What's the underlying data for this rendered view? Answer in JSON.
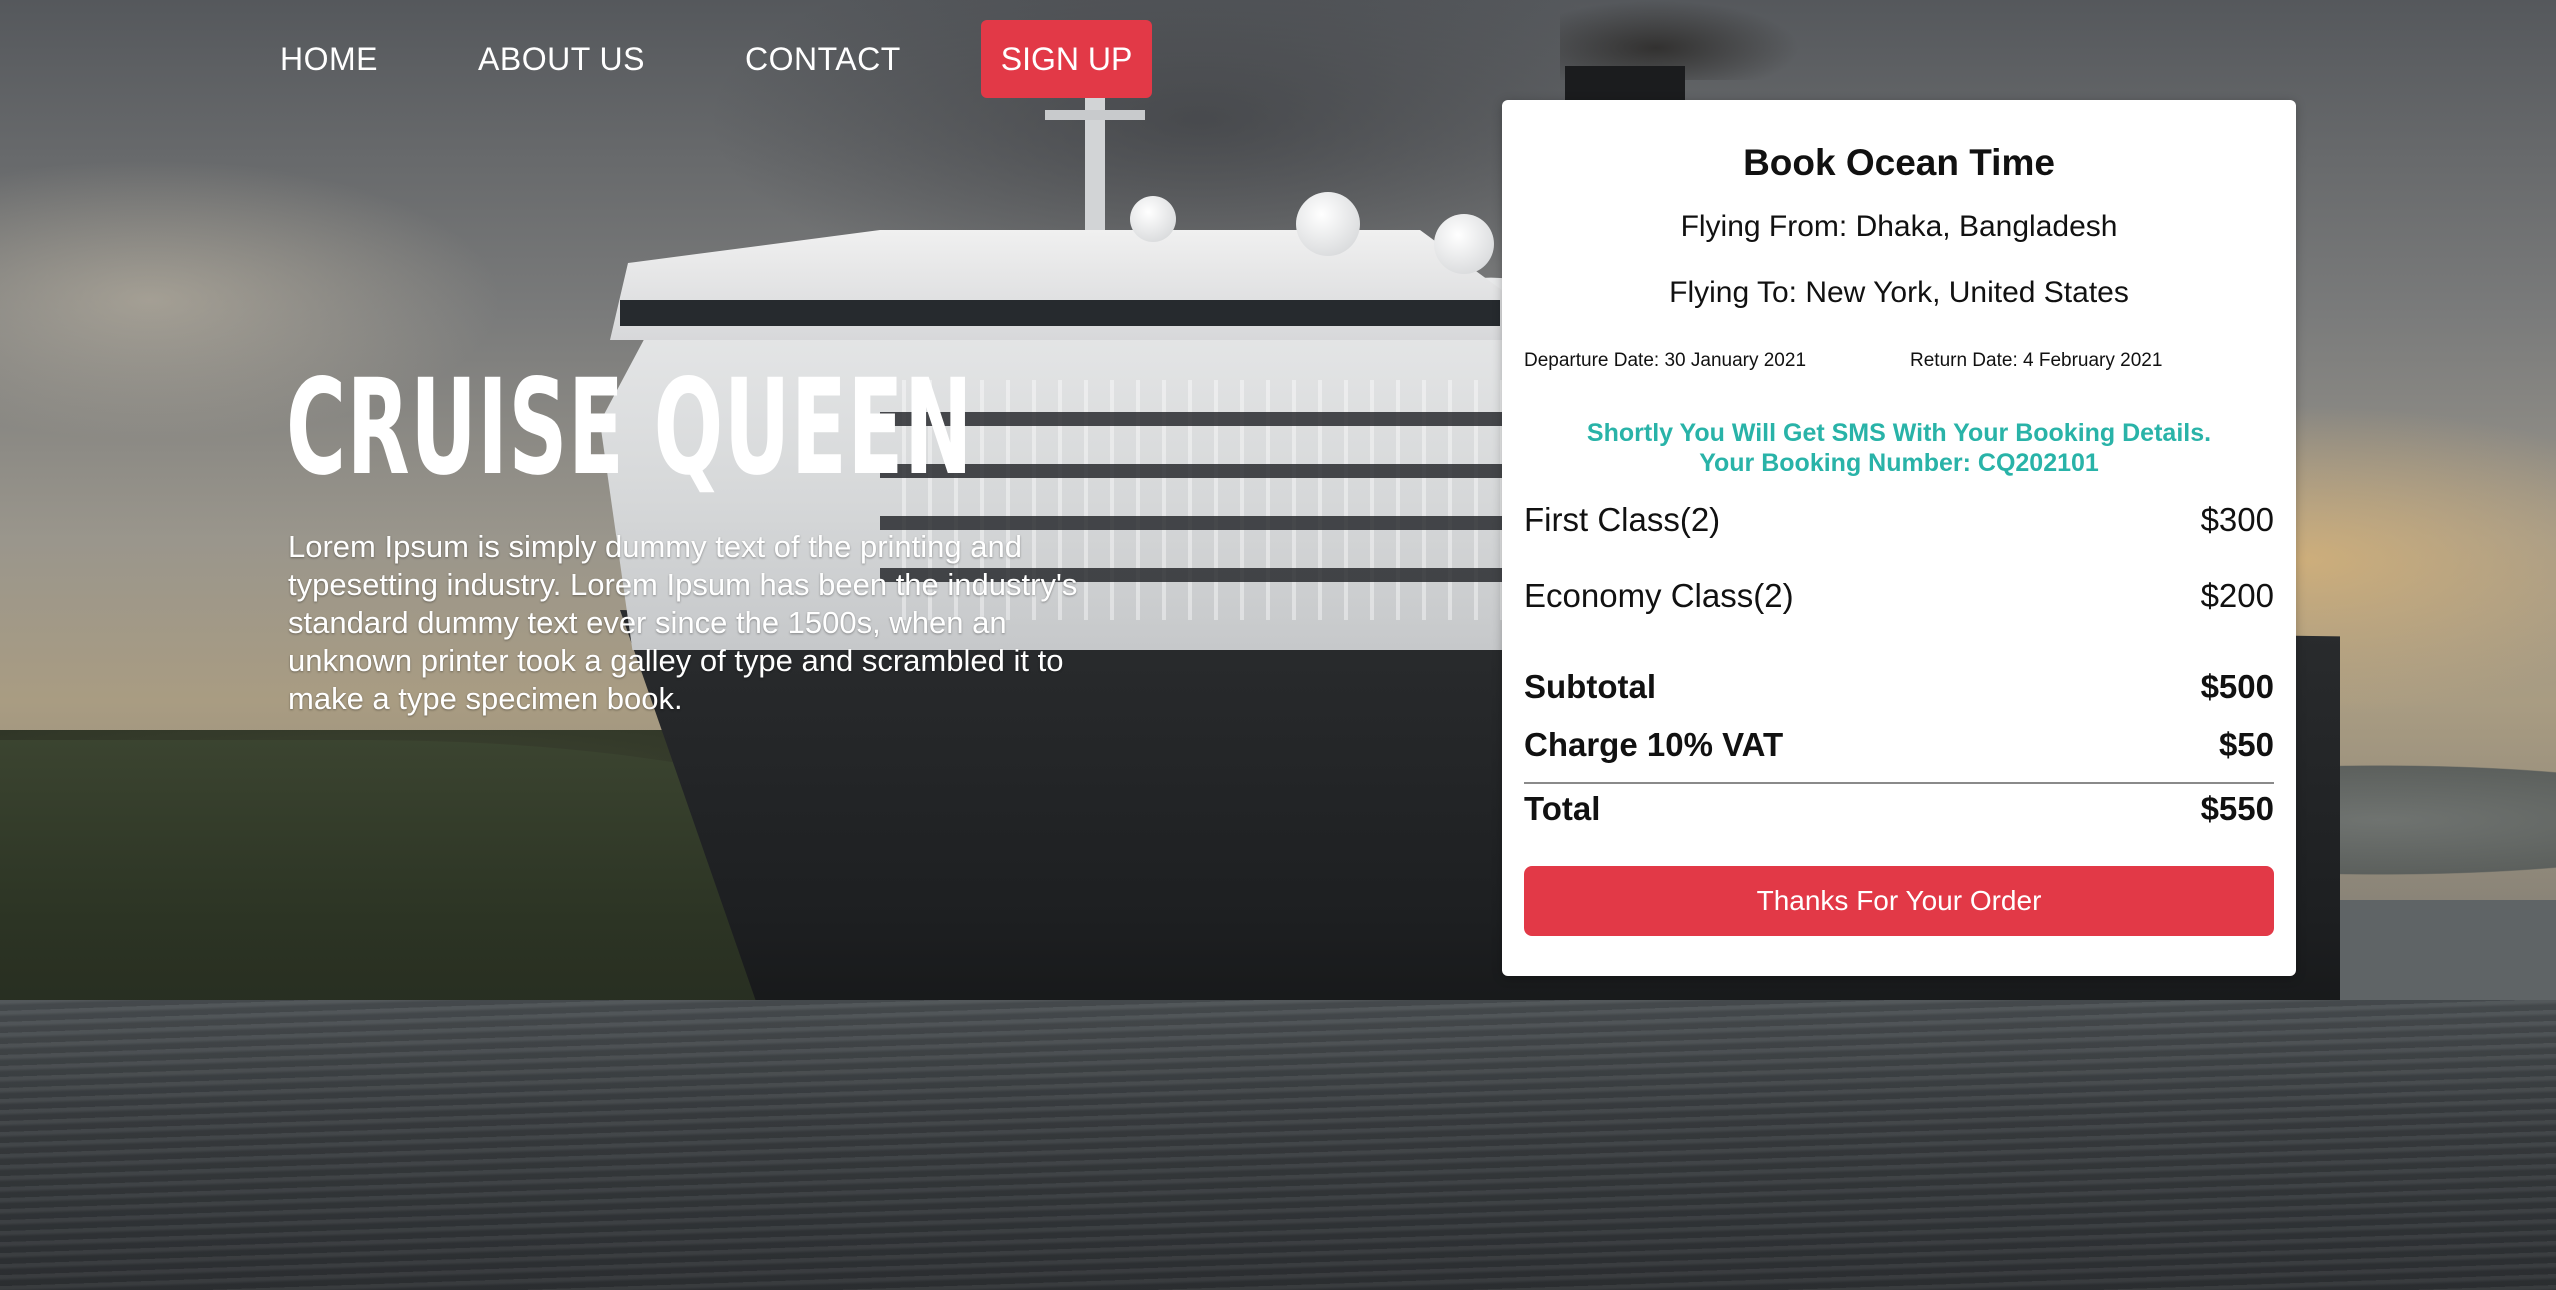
{
  "nav": {
    "items": [
      "HOME",
      "ABOUT US",
      "CONTACT"
    ],
    "signup_label": "SIGN UP"
  },
  "hero": {
    "title": "CRUISE QUEEN",
    "text": "Lorem Ipsum is simply dummy text of the printing and typesetting industry. Lorem Ipsum has been the industry's standard dummy text ever since the 1500s, when an unknown printer took a galley of type and scrambled it to make a type specimen book."
  },
  "booking": {
    "title": "Book Ocean Time",
    "flying_from": "Flying From: Dhaka, Bangladesh",
    "flying_to": "Flying To: New York, United States",
    "departure": "Departure Date: 30 January 2021",
    "return": "Return Date: 4 February 2021",
    "sms_line1": "Shortly You Will Get SMS With Your Booking Details.",
    "sms_line2": "Your Booking Number: CQ202101",
    "first_class": {
      "label": "First Class(2)",
      "amount": "$300"
    },
    "economy_class": {
      "label": "Economy Class(2)",
      "amount": "$200"
    },
    "subtotal": {
      "label": "Subtotal",
      "amount": "$500"
    },
    "vat": {
      "label": "Charge 10% VAT",
      "amount": "$50"
    },
    "total": {
      "label": "Total",
      "amount": "$550"
    },
    "button_label": "Thanks For Your Order"
  },
  "colors": {
    "accent": "#e23947",
    "sms_text": "#29b3a8"
  }
}
